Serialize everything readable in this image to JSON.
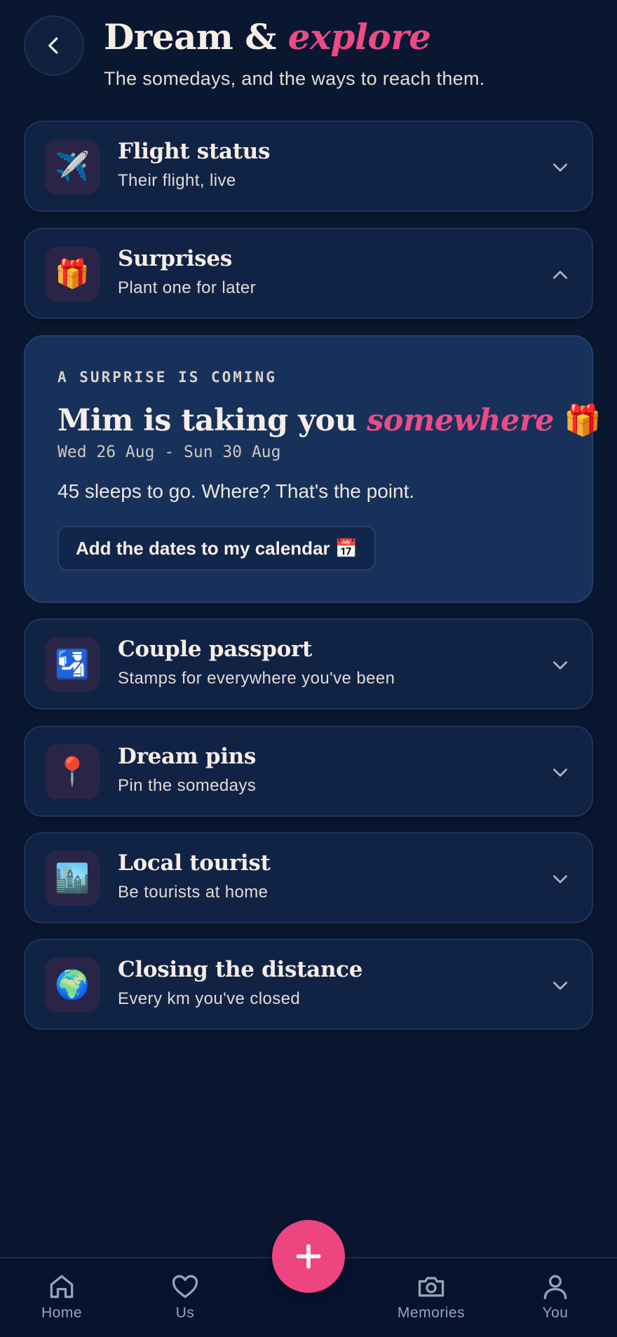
{
  "header": {
    "title_main": "Dream &",
    "title_accent": "explore",
    "subtitle": "The somedays, and the ways to reach them."
  },
  "sections": [
    {
      "icon": "✈️",
      "icon_name": "airplane-icon",
      "title": "Flight status",
      "subtitle": "Their flight, live",
      "expanded": false
    },
    {
      "icon": "🎁",
      "icon_name": "gift-icon",
      "title": "Surprises",
      "subtitle": "Plant one for later",
      "expanded": true
    },
    {
      "icon": "🛂",
      "icon_name": "passport-control-icon",
      "title": "Couple passport",
      "subtitle": "Stamps for everywhere you've been",
      "expanded": false
    },
    {
      "icon": "📍",
      "icon_name": "pin-icon",
      "title": "Dream pins",
      "subtitle": "Pin the somedays",
      "expanded": false
    },
    {
      "icon": "🏙️",
      "icon_name": "cityscape-icon",
      "title": "Local tourist",
      "subtitle": "Be tourists at home",
      "expanded": false
    },
    {
      "icon": "🌍",
      "icon_name": "globe-icon",
      "title": "Closing the distance",
      "subtitle": "Every km you've closed",
      "expanded": false
    }
  ],
  "surprise": {
    "eyebrow": "A SURPRISE IS COMING",
    "headline_main": "Mim is taking you",
    "headline_accent": "somewhere",
    "headline_emoji": "🎁",
    "dates": "Wed 26 Aug - Sun 30 Aug",
    "body": "45 sleeps to go. Where? That's the point.",
    "button_label": "Add the dates to my calendar 📅"
  },
  "nav": {
    "items": [
      {
        "label": "Home",
        "icon_name": "home-icon"
      },
      {
        "label": "Us",
        "icon_name": "heart-icon"
      },
      {
        "label": "Memories",
        "icon_name": "camera-icon"
      },
      {
        "label": "You",
        "icon_name": "person-icon"
      }
    ],
    "fab_icon_name": "plus-icon"
  },
  "colors": {
    "background": "#0a1730",
    "card": "#112345",
    "surprise_card": "#17315a",
    "accent": "#ee4a86",
    "text": "#f6ede6"
  }
}
